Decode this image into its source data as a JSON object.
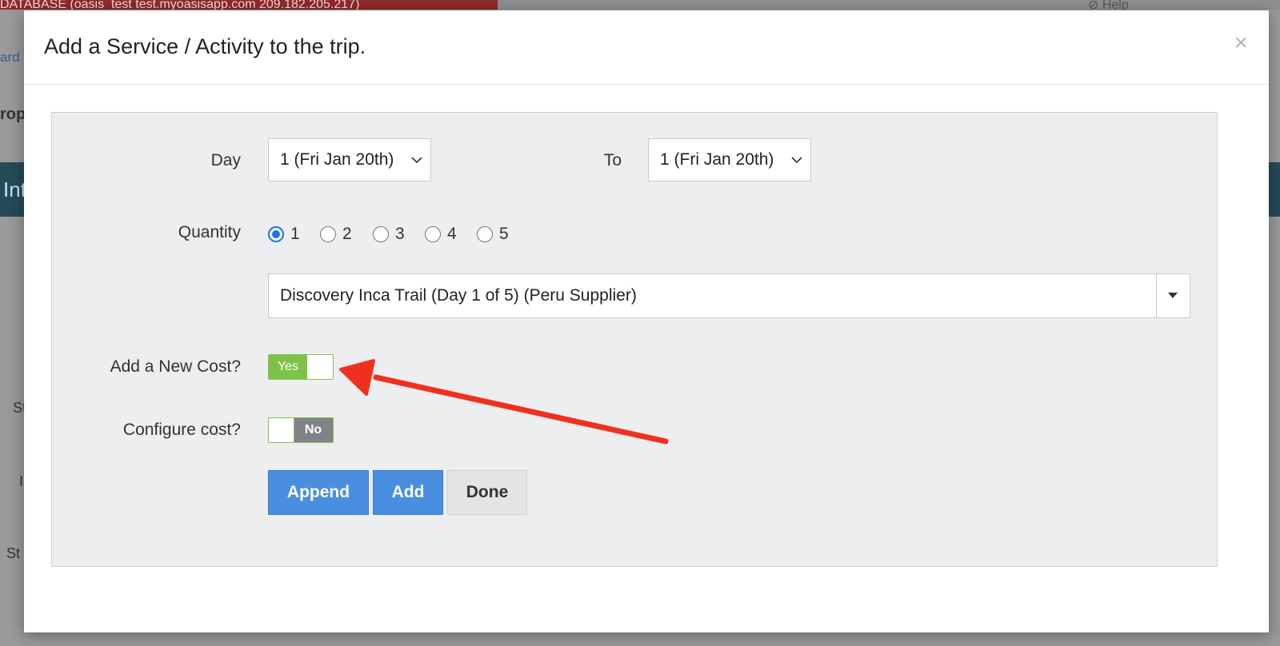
{
  "background": {
    "db_banner": "DATABASE (oasis_test test.myoasisapp.com 209.182.205.217)",
    "help": "⊘ Help",
    "nav_fragment": "ard",
    "heading_fragment": "rop",
    "teal_fragment": "Int",
    "side_fragments": [
      "St",
      "I",
      "St"
    ]
  },
  "modal": {
    "title": "Add a Service / Activity to the trip.",
    "close_symbol": "×"
  },
  "form": {
    "day_label": "Day",
    "day_value": "1 (Fri Jan 20th)",
    "to_label": "To",
    "to_value": "1 (Fri Jan 20th)",
    "quantity_label": "Quantity",
    "quantity_options": [
      "1",
      "2",
      "3",
      "4",
      "5"
    ],
    "quantity_selected": "1",
    "service_value": "Discovery Inca Trail (Day 1 of 5) (Peru Supplier)",
    "new_cost_label": "Add a New Cost?",
    "new_cost_toggle": "Yes",
    "configure_cost_label": "Configure cost?",
    "configure_cost_toggle": "No"
  },
  "buttons": {
    "append": "Append",
    "add": "Add",
    "done": "Done"
  },
  "colors": {
    "primary_button": "#4a8fdf",
    "toggle_on": "#7fc24a",
    "toggle_off": "#808387",
    "annotation_arrow": "#f0301e",
    "radio_checked": "#1a73e8"
  }
}
